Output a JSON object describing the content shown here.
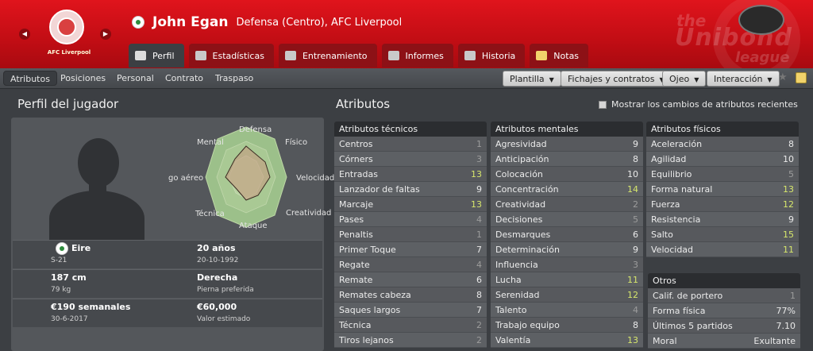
{
  "header": {
    "club_crest_label": "AFC Liverpool",
    "player_name": "John Egan",
    "player_position": "Defensa (Centro), AFC Liverpool",
    "tabs": [
      {
        "label": "Perfil",
        "icon": "profile-icon"
      },
      {
        "label": "Estadísticas",
        "icon": "stats-icon"
      },
      {
        "label": "Entrenamiento",
        "icon": "training-icon"
      },
      {
        "label": "Informes",
        "icon": "report-icon"
      },
      {
        "label": "Historia",
        "icon": "history-icon"
      },
      {
        "label": "Notas",
        "icon": "notes-icon"
      }
    ]
  },
  "subnav": {
    "items": [
      "Atributos",
      "Posiciones",
      "Personal",
      "Contrato",
      "Traspaso"
    ],
    "dropdowns": [
      "Plantilla",
      "Fichajes y contratos",
      "Ojeo",
      "Interacción"
    ]
  },
  "profile": {
    "title": "Perfil del jugador",
    "radar_labels": [
      "Defensa",
      "Físico",
      "Velocidad",
      "Creatividad",
      "Ataque",
      "Técnica",
      "go aéreo",
      "Mental"
    ],
    "nationality": "Eire",
    "nat_sub": "S-21",
    "age": "20 años",
    "dob": "20-10-1992",
    "height": "187 cm",
    "weight": "79 kg",
    "foot": "Derecha",
    "foot_label": "Pierna preferida",
    "wage": "€190 semanales",
    "contract_end": "30-6-2017",
    "value": "€60,000",
    "value_label": "Valor estimado"
  },
  "attributes": {
    "title": "Atributos",
    "show_changes_label": "Mostrar los cambios de atributos recientes",
    "technical": {
      "header": "Atributos técnicos",
      "rows": [
        {
          "name": "Centros",
          "value": "1"
        },
        {
          "name": "Córners",
          "value": "3"
        },
        {
          "name": "Entradas",
          "value": "13"
        },
        {
          "name": "Lanzador de faltas",
          "value": "9"
        },
        {
          "name": "Marcaje",
          "value": "13"
        },
        {
          "name": "Pases",
          "value": "4"
        },
        {
          "name": "Penaltis",
          "value": "1"
        },
        {
          "name": "Primer Toque",
          "value": "7"
        },
        {
          "name": "Regate",
          "value": "4"
        },
        {
          "name": "Remate",
          "value": "6"
        },
        {
          "name": "Remates cabeza",
          "value": "8"
        },
        {
          "name": "Saques largos",
          "value": "7"
        },
        {
          "name": "Técnica",
          "value": "2"
        },
        {
          "name": "Tiros lejanos",
          "value": "2"
        }
      ]
    },
    "mental": {
      "header": "Atributos mentales",
      "rows": [
        {
          "name": "Agresividad",
          "value": "9"
        },
        {
          "name": "Anticipación",
          "value": "8"
        },
        {
          "name": "Colocación",
          "value": "10"
        },
        {
          "name": "Concentración",
          "value": "14"
        },
        {
          "name": "Creatividad",
          "value": "2"
        },
        {
          "name": "Decisiones",
          "value": "5"
        },
        {
          "name": "Desmarques",
          "value": "6"
        },
        {
          "name": "Determinación",
          "value": "9"
        },
        {
          "name": "Influencia",
          "value": "3"
        },
        {
          "name": "Lucha",
          "value": "11"
        },
        {
          "name": "Serenidad",
          "value": "12"
        },
        {
          "name": "Talento",
          "value": "4"
        },
        {
          "name": "Trabajo equipo",
          "value": "8"
        },
        {
          "name": "Valentía",
          "value": "13"
        }
      ]
    },
    "physical": {
      "header": "Atributos físicos",
      "rows": [
        {
          "name": "Aceleración",
          "value": "8"
        },
        {
          "name": "Agilidad",
          "value": "10"
        },
        {
          "name": "Equilibrio",
          "value": "5"
        },
        {
          "name": "Forma natural",
          "value": "13"
        },
        {
          "name": "Fuerza",
          "value": "12"
        },
        {
          "name": "Resistencia",
          "value": "9"
        },
        {
          "name": "Salto",
          "value": "15"
        },
        {
          "name": "Velocidad",
          "value": "11"
        }
      ]
    },
    "other": {
      "header": "Otros",
      "rows": [
        {
          "name": "Calif. de portero",
          "value": "1"
        },
        {
          "name": "Forma física",
          "value": "77%"
        },
        {
          "name": "Últimos 5 partidos",
          "value": "7.10"
        },
        {
          "name": "Moral",
          "value": "Exultante"
        }
      ]
    }
  },
  "colors": {
    "header_red": "#d0111a",
    "panel_bg": "#3c3f43",
    "high_value": "#d6e66c"
  }
}
